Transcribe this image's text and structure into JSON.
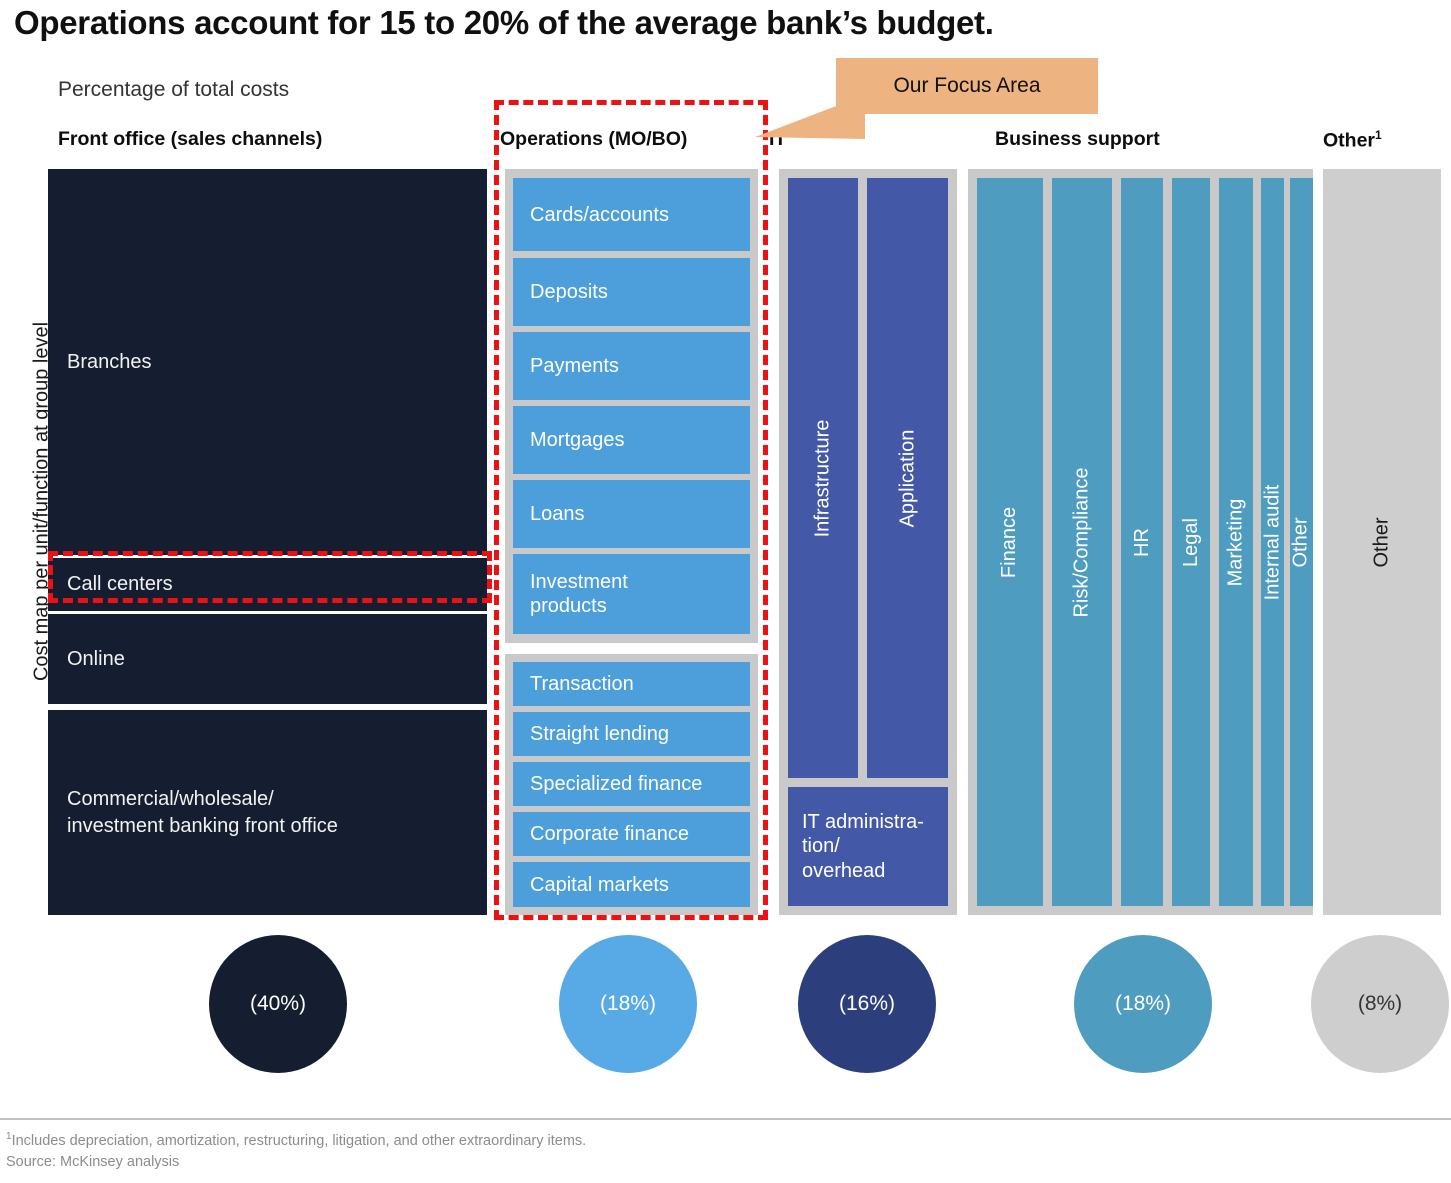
{
  "title": "Operations account for 15 to 20% of the average bank’s budget.",
  "subtitle": "Percentage of total costs",
  "y_axis_label": "Cost map per unit/function at group level",
  "callout": {
    "label": "Our Focus Area",
    "color": "#edb380"
  },
  "headers": {
    "front_office": "Front office (sales channels)",
    "operations": "Operations (MO/BO)",
    "it": "IT",
    "business_support": "Business support",
    "other": "Other",
    "other_sup": "1"
  },
  "colors": {
    "front_office": "#141e30",
    "operations": "#4d9fdb",
    "it": "#4458a8",
    "business_support": "#4e9cc0",
    "other": "#cecece",
    "container": "#c9c9c9",
    "highlight": "#ee1111"
  },
  "front_office": {
    "items": [
      {
        "label": "Branches"
      },
      {
        "label": "Call centers",
        "highlighted": true
      },
      {
        "label": "Online"
      },
      {
        "label": "Commercial/wholesale/\ninvestment banking front office"
      }
    ]
  },
  "operations": {
    "group_1": [
      {
        "label": "Cards/accounts"
      },
      {
        "label": "Deposits"
      },
      {
        "label": "Payments"
      },
      {
        "label": "Mortgages"
      },
      {
        "label": "Loans"
      },
      {
        "label": "Investment\nproducts"
      }
    ],
    "group_2": [
      {
        "label": "Transaction"
      },
      {
        "label": "Straight lending"
      },
      {
        "label": "Specialized finance"
      },
      {
        "label": "Corporate finance"
      },
      {
        "label": "Capital markets"
      }
    ]
  },
  "it": {
    "vertical_bars": [
      {
        "label": "Infrastructure"
      },
      {
        "label": "Application"
      }
    ],
    "admin": {
      "label": "IT administra-\ntion/\noverhead"
    }
  },
  "business_support": {
    "items": [
      {
        "label": "Finance"
      },
      {
        "label": "Risk/Compliance"
      },
      {
        "label": "HR"
      },
      {
        "label": "Legal"
      },
      {
        "label": "Marketing"
      },
      {
        "label": "Internal audit"
      },
      {
        "label": "Other"
      }
    ]
  },
  "other_column": {
    "label": "Other"
  },
  "bubbles": [
    {
      "label": "(40%)",
      "color": "#141e30",
      "text_color": "#ffffff"
    },
    {
      "label": "(18%)",
      "color": "#58aae6",
      "text_color": "#ffffff"
    },
    {
      "label": "(16%)",
      "color": "#2c3f7c",
      "text_color": "#ffffff"
    },
    {
      "label": "(18%)",
      "color": "#4e9cc0",
      "text_color": "#ffffff"
    },
    {
      "label": "(8%)",
      "color": "#cecece",
      "text_color": "#333333"
    }
  ],
  "footnotes": {
    "note": "Includes depreciation, amortization, restructuring, litigation, and other extraordinary items.",
    "note_marker": "1",
    "source": "Source: McKinsey analysis"
  },
  "chart_data": {
    "type": "bar",
    "title": "Operations account for 15 to 20% of the average bank’s budget.",
    "subtitle": "Percentage of total costs",
    "ylabel": "Cost map per unit/function at group level",
    "categories": [
      "Front office (sales channels)",
      "Operations (MO/BO)",
      "IT",
      "Business support",
      "Other"
    ],
    "values": [
      40,
      18,
      16,
      18,
      8
    ],
    "value_labels": [
      "(40%)",
      "(18%)",
      "(16%)",
      "(18%)",
      "(8%)"
    ],
    "unit": "percent of total costs",
    "grid": false,
    "legend": "none",
    "breakdown": {
      "Front office (sales channels)": [
        "Branches",
        "Call centers",
        "Online",
        "Commercial/wholesale/investment banking front office"
      ],
      "Operations (MO/BO)": [
        "Cards/accounts",
        "Deposits",
        "Payments",
        "Mortgages",
        "Loans",
        "Investment products",
        "Transaction",
        "Straight lending",
        "Specialized finance",
        "Corporate finance",
        "Capital markets"
      ],
      "IT": [
        "Infrastructure",
        "Application",
        "IT administration/overhead"
      ],
      "Business support": [
        "Finance",
        "Risk/Compliance",
        "HR",
        "Legal",
        "Marketing",
        "Internal audit",
        "Other"
      ],
      "Other": [
        "Other"
      ]
    },
    "annotations": [
      "Our Focus Area"
    ]
  }
}
